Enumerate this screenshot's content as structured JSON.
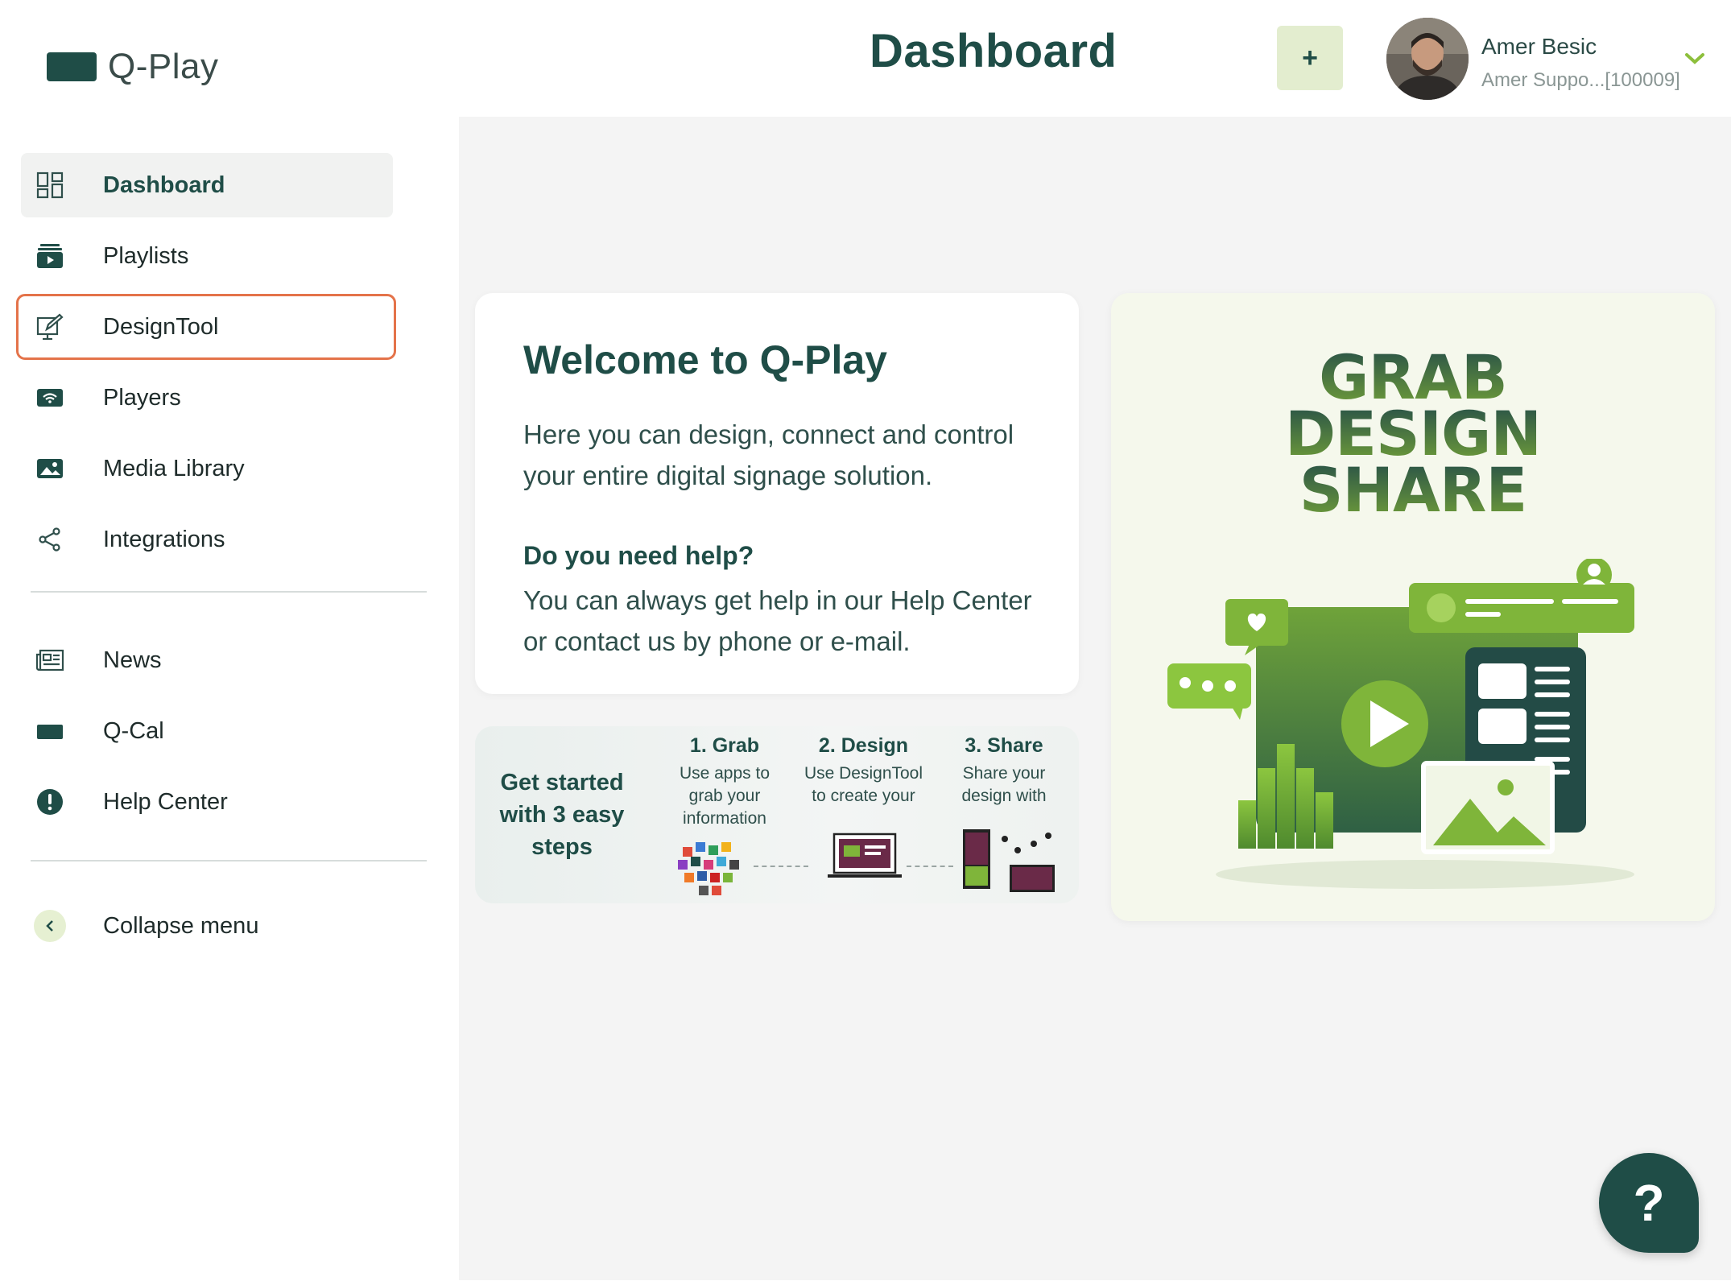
{
  "app": {
    "logo_text": "Q-Play"
  },
  "header": {
    "title": "Dashboard",
    "add_label": "+",
    "user_name": "Amer Besic",
    "user_subtitle": "Amer Suppo...[100009]"
  },
  "sidebar": {
    "items": [
      {
        "label": "Dashboard",
        "icon": "dashboard-grid-icon"
      },
      {
        "label": "Playlists",
        "icon": "playlist-icon"
      },
      {
        "label": "DesignTool",
        "icon": "design-edit-icon"
      },
      {
        "label": "Players",
        "icon": "player-wifi-icon"
      },
      {
        "label": "Media Library",
        "icon": "media-image-icon"
      },
      {
        "label": "Integrations",
        "icon": "share-nodes-icon"
      }
    ],
    "secondary": [
      {
        "label": "News",
        "icon": "newspaper-icon"
      },
      {
        "label": "Q-Cal",
        "icon": "qcal-icon"
      },
      {
        "label": "Help Center",
        "icon": "alert-circle-icon"
      }
    ],
    "collapse_label": "Collapse menu"
  },
  "welcome": {
    "title": "Welcome to Q-Play",
    "text": "Here you can design, connect and control your entire digital signage solution.",
    "help_title": "Do you need help?",
    "help_text": "You can always get help in our Help Center or contact us by phone or e-mail."
  },
  "steps": {
    "heading": "Get started with 3 easy steps",
    "items": [
      {
        "title": "1. Grab",
        "desc": "Use apps to grab your information"
      },
      {
        "title": "2. Design",
        "desc": "Use DesignTool to create your"
      },
      {
        "title": "3. Share",
        "desc": "Share your design with"
      }
    ]
  },
  "promo": {
    "lines": [
      "GRAB",
      "DESIGN",
      "SHARE"
    ]
  },
  "help_fab": {
    "label": "?"
  },
  "colors": {
    "brand": "#1f4d47",
    "accent_green": "#7fb53a",
    "highlight": "#e4734a",
    "main_bg": "#f4f4f4"
  }
}
